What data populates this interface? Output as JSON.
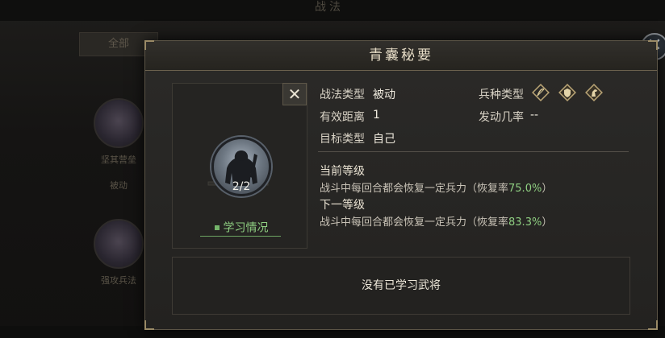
{
  "background": {
    "title": "战法",
    "tab_label": "全部",
    "items": [
      {
        "label": "坚其营垒",
        "sub": "被动"
      },
      {
        "label": "强攻兵法",
        "sub": ""
      }
    ],
    "close_icon": "crossed-swords-close-icon"
  },
  "modal": {
    "title": "青囊秘要",
    "close_label": "✕",
    "skill": {
      "icon": "warrior-portrait-icon",
      "level": "2/2",
      "study_link": "学习情况"
    },
    "info": {
      "tactic_type_label": "战法类型",
      "tactic_type_value": "被动",
      "range_label": "有效距离",
      "range_value": "1",
      "target_label": "目标类型",
      "target_value": "自己",
      "troop_label": "兵种类型",
      "troop_icons": [
        "bow-icon",
        "shield-icon",
        "horse-icon"
      ],
      "rate_label": "发动几率",
      "rate_value": "--"
    },
    "current_level": {
      "title": "当前等级",
      "desc": "战斗中每回合都会恢复一定兵力（恢复率",
      "pct": "75.0%",
      "close": "）"
    },
    "next_level": {
      "title": "下一等级",
      "desc": "战斗中每回合都会恢复一定兵力（恢复率",
      "pct": "83.3%",
      "close": "）"
    },
    "generals_text": "没有已学习武将"
  },
  "colors": {
    "accent_green": "#8fcf82",
    "gold_border": "#9a8a66",
    "panel_bg": "#2b2a28"
  }
}
